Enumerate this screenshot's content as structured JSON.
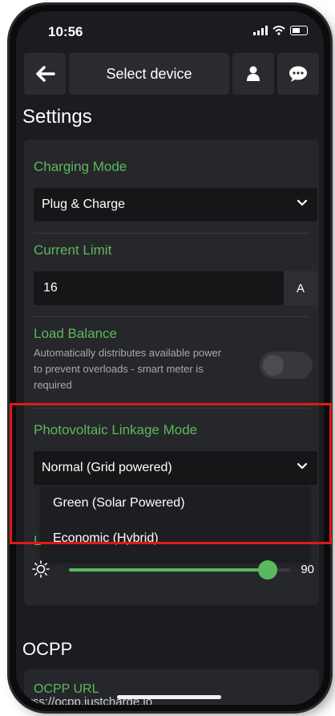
{
  "status_bar": {
    "time": "10:56"
  },
  "header": {
    "title": "Select device"
  },
  "settings": {
    "title": "Settings",
    "charging_mode": {
      "label": "Charging Mode",
      "value": "Plug & Charge"
    },
    "current_limit": {
      "label": "Current Limit",
      "value": "16",
      "unit": "A"
    },
    "load_balance": {
      "label": "Load Balance",
      "description": "Automatically distributes available power to prevent overloads - smart meter is required",
      "enabled": false
    },
    "pv_mode": {
      "label": "Photovoltaic Linkage Mode",
      "value": "Normal (Grid powered)",
      "options": [
        "Green (Solar Powered)",
        "Economic (Hybrid)"
      ]
    },
    "obscured_label": "L",
    "brightness": {
      "value": 90,
      "fraction": 0.9
    }
  },
  "ocpp": {
    "title": "OCPP",
    "url_label": "OCPP URL",
    "url_value": "wss://ocpp.justcharge.io"
  },
  "colors": {
    "accent": "#5cb85c",
    "highlight": "#e21818",
    "background": "#1b1c1f"
  }
}
